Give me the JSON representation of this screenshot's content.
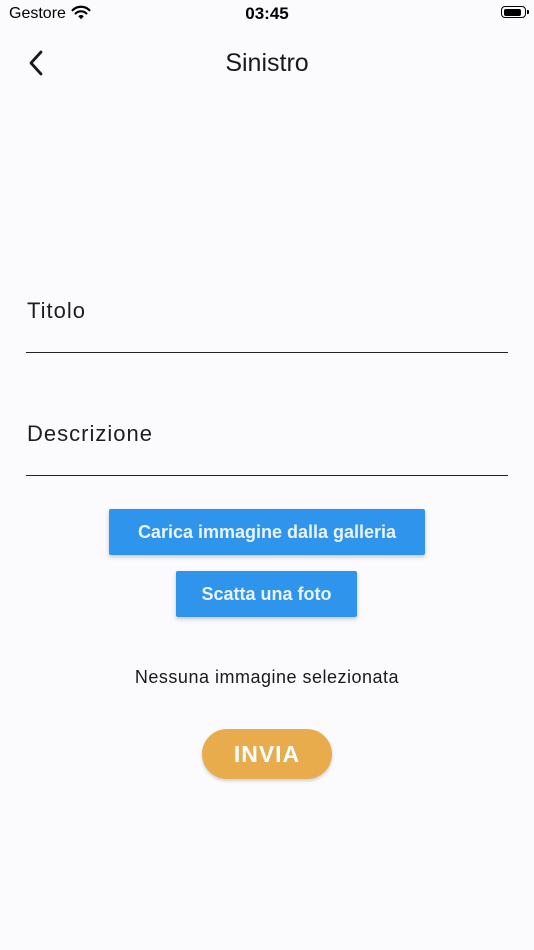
{
  "status_bar": {
    "carrier": "Gestore",
    "time": "03:45",
    "battery_level": 0.92
  },
  "nav": {
    "title": "Sinistro",
    "back_icon": "chevron-left-icon"
  },
  "form": {
    "title_label": "Titolo",
    "description_label": "Descrizione"
  },
  "actions": {
    "gallery_label": "Carica immagine dalla galleria",
    "camera_label": "Scatta una foto",
    "no_image_text": "Nessuna immagine selezionata",
    "submit_label": "INVIA"
  },
  "colors": {
    "primary_blue": "#2f95ec",
    "submit_orange": "#e8ac4c",
    "background": "#fbfbfd"
  }
}
